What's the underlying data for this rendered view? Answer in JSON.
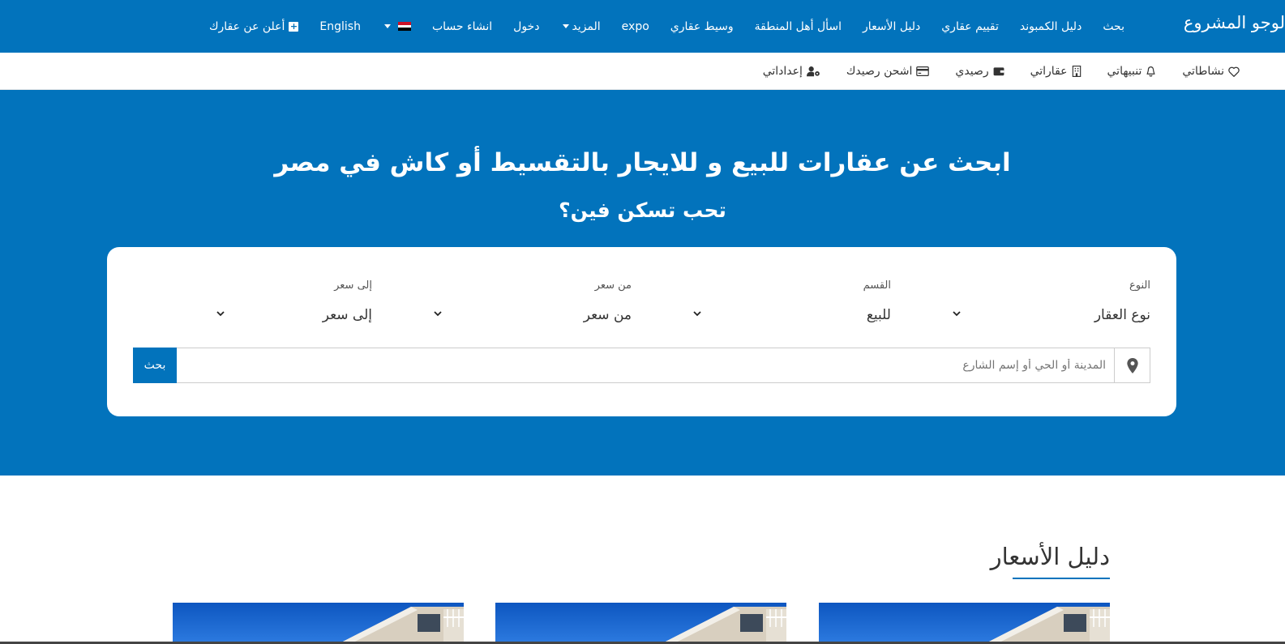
{
  "topnav": {
    "logo": "لوجو المشروع",
    "links": [
      "بحث",
      "دليل الكمبوند",
      "تقييم عقاري",
      "دليل الأسعار",
      "اسأل أهل المنطقة",
      "وسيط عقاري",
      "expo",
      "المزيد",
      "دخول",
      "انشاء حساب",
      "",
      "English",
      "أعلن عن عقارك"
    ],
    "flag_colors": [
      "#ce1126",
      "#ffffff",
      "#000000"
    ]
  },
  "subnav": {
    "links": [
      "نشاطاتي",
      "تنبيهاتي",
      "عقاراتي",
      "رصيدي",
      "اشحن رصيدك",
      "إعداداتي"
    ]
  },
  "hero": {
    "title": "ابحث عن عقارات للبيع و للايجار بالتقسيط أو كاش في مصر",
    "subtitle": "تحب تسكن فين؟"
  },
  "search": {
    "fields": [
      {
        "label": "النوع",
        "value": "نوع العقار"
      },
      {
        "label": "القسم",
        "value": "للبيع"
      },
      {
        "label": "من سعر",
        "value": "من سعر"
      },
      {
        "label": "إلى سعر",
        "value": "إلى سعر"
      }
    ],
    "placeholder": "المدينة أو الحي أو إسم الشارع",
    "button": "بحث"
  },
  "section": {
    "title": "دليل الأسعار"
  },
  "colors": {
    "brand": "#0273bc"
  }
}
